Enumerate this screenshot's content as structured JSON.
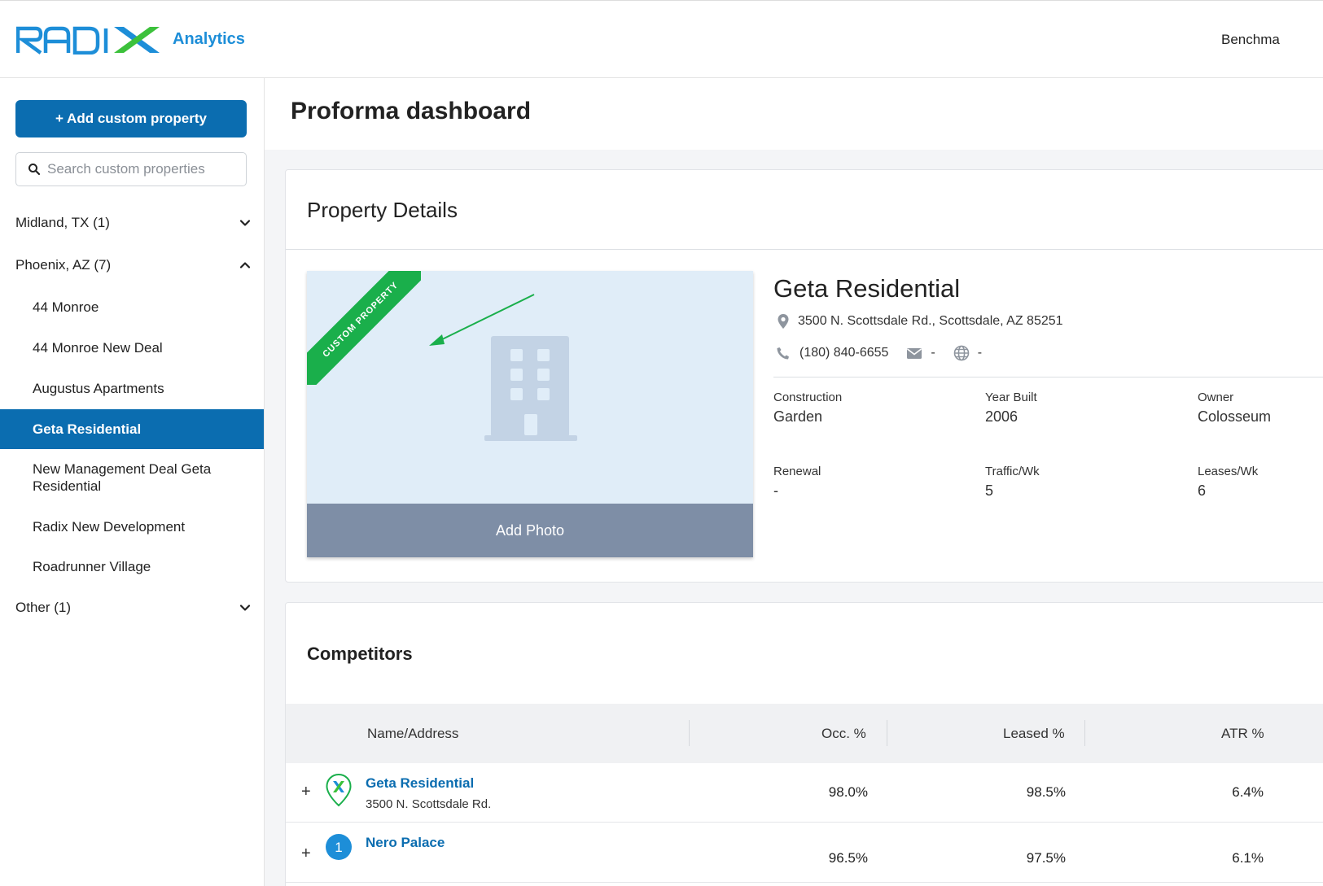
{
  "header": {
    "logo_text": "RADIX",
    "logo_sub": "Analytics",
    "nav_right": "Benchma"
  },
  "sidebar": {
    "add_button": "+ Add custom property",
    "search_placeholder": "Search custom properties",
    "groups": [
      {
        "label": "Midland, TX (1)",
        "expanded": false
      },
      {
        "label": "Phoenix, AZ (7)",
        "expanded": true
      },
      {
        "label": "Other (1)",
        "expanded": false
      }
    ],
    "phoenix_items": [
      "44 Monroe",
      "44 Monroe New Deal",
      "Augustus Apartments",
      "Geta Residential",
      "New Management Deal Geta Residential",
      "Radix New Development",
      "Roadrunner Village"
    ],
    "active_item": "Geta Residential"
  },
  "page": {
    "title": "Proforma dashboard"
  },
  "details": {
    "card_title": "Property Details",
    "ribbon": "CUSTOM PROPERTY",
    "add_photo": "Add Photo",
    "name": "Geta Residential",
    "address": "3500 N. Scottsdale Rd., Scottsdale, AZ 85251",
    "phone": "(180) 840-6655",
    "email": "-",
    "website": "-",
    "facts": [
      {
        "label": "Construction",
        "value": "Garden"
      },
      {
        "label": "Year Built",
        "value": "2006"
      },
      {
        "label": "Owner",
        "value": "Colosseum"
      },
      {
        "label": "Renewal",
        "value": "-"
      },
      {
        "label": "Traffic/Wk",
        "value": "5"
      },
      {
        "label": "Leases/Wk",
        "value": "6"
      }
    ]
  },
  "competitors": {
    "title": "Competitors",
    "columns": [
      "Name/Address",
      "Occ. %",
      "Leased %",
      "ATR %"
    ],
    "rows": [
      {
        "marker": "X",
        "name": "Geta Residential",
        "address": "3500 N. Scottsdale Rd.",
        "occ": "98.0%",
        "leased": "98.5%",
        "atr": "6.4%"
      },
      {
        "marker": "1",
        "name": "Nero Palace",
        "address": "",
        "occ": "96.5%",
        "leased": "97.5%",
        "atr": "6.1%"
      }
    ]
  },
  "colors": {
    "primary": "#0b6db0",
    "ribbon": "#1aaf4b",
    "logo_blue": "#1d8ed8",
    "logo_green": "#3cc13b"
  },
  "icons": [
    "search-icon",
    "chevron-down-icon",
    "chevron-up-icon",
    "building-icon",
    "location-pin-icon",
    "phone-icon",
    "mail-icon",
    "globe-icon",
    "plus-icon",
    "map-marker-icon",
    "arrow-annotation"
  ]
}
